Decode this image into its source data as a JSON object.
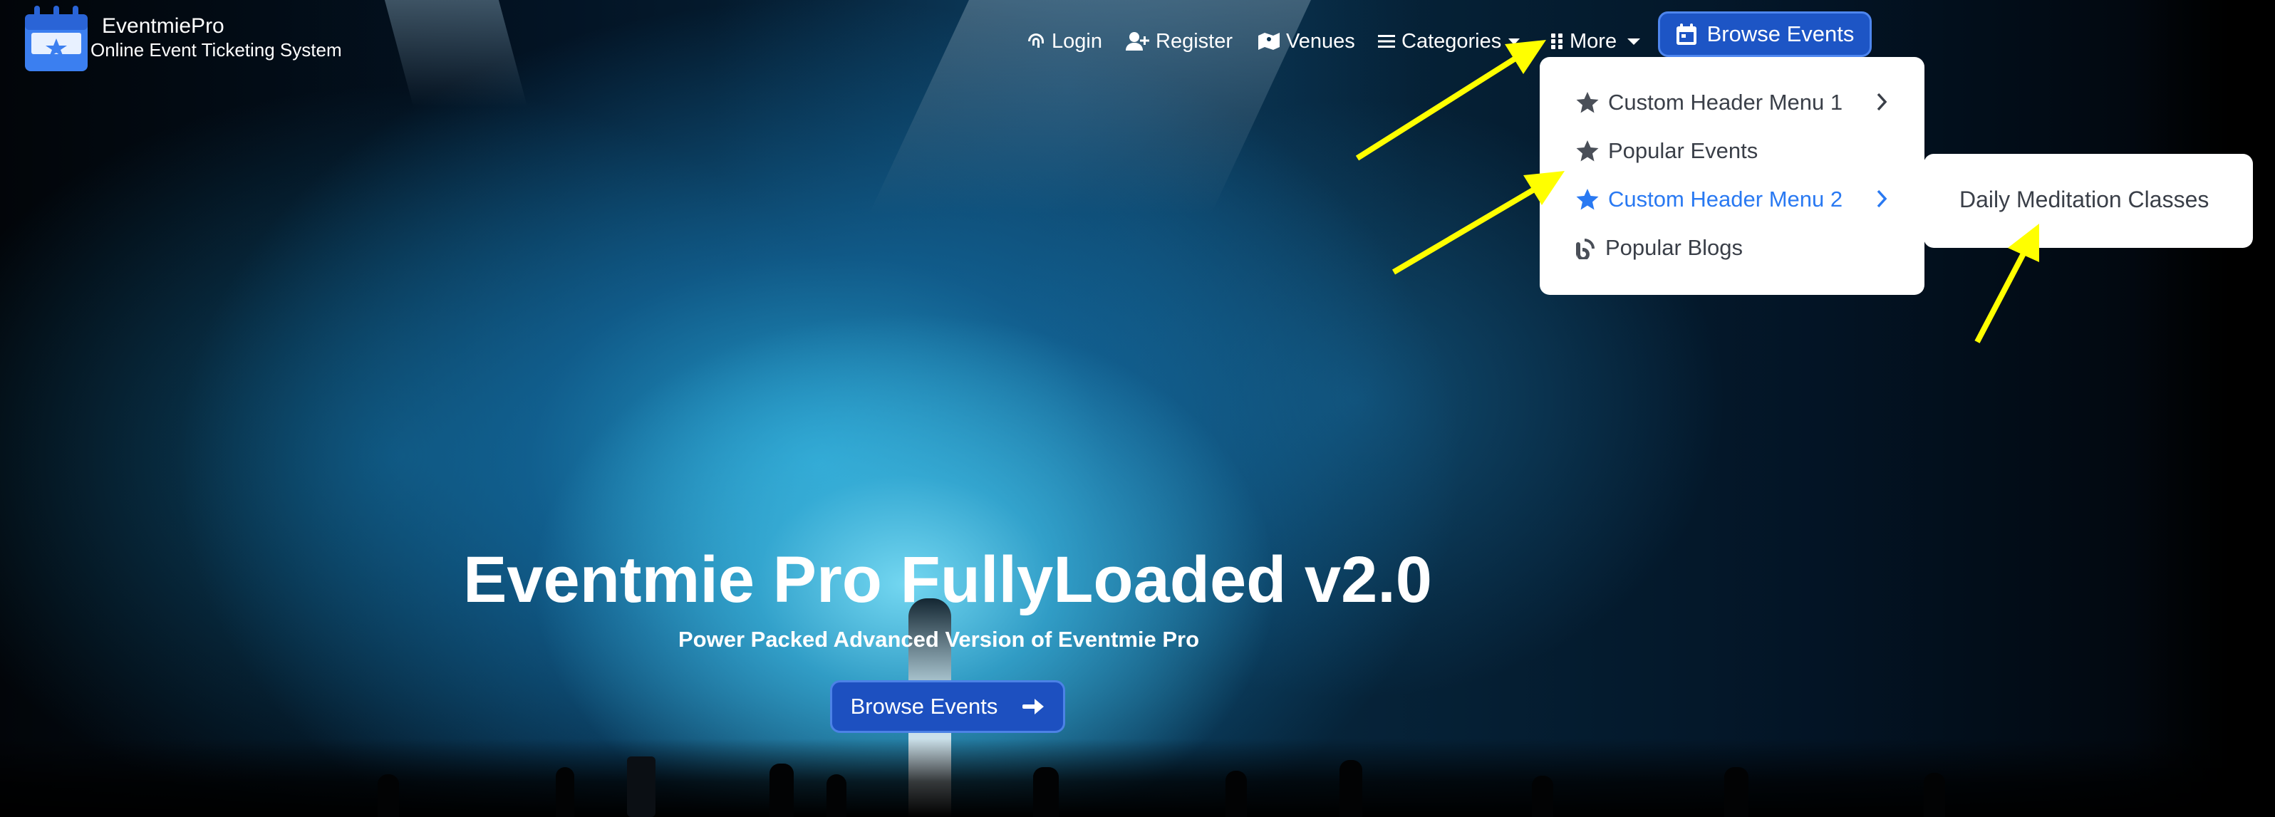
{
  "brand": {
    "name": "EventmiePro",
    "tagline": "Online Event Ticketing System"
  },
  "nav": {
    "login": "Login",
    "register": "Register",
    "venues": "Venues",
    "categories": "Categories",
    "more": "More",
    "browse_events": "Browse Events"
  },
  "more_menu": {
    "items": [
      {
        "label": "Custom Header Menu 1",
        "icon": "star-icon",
        "has_submenu": true
      },
      {
        "label": "Popular Events",
        "icon": "star-icon",
        "has_submenu": false
      },
      {
        "label": "Custom Header Menu 2",
        "icon": "star-icon",
        "has_submenu": true,
        "active": true
      },
      {
        "label": "Popular Blogs",
        "icon": "blog-icon",
        "has_submenu": false
      }
    ],
    "submenu": {
      "items": [
        "Daily Meditation Classes"
      ]
    }
  },
  "hero": {
    "title": "Eventmie Pro FullyLoaded v2.0",
    "subtitle": "Power Packed Advanced Version of Eventmie Pro",
    "cta": "Browse Events"
  },
  "colors": {
    "accent": "#1d55c5",
    "active_menu": "#2979f2",
    "annotation_arrow": "#ffff00"
  }
}
